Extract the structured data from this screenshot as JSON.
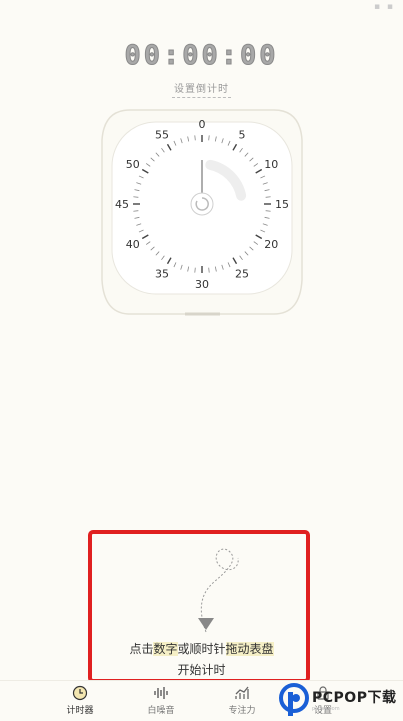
{
  "status_icons": "▪ ▪",
  "timer": {
    "display": "00:00:00",
    "set_countdown_label": "设置倒计时",
    "dial_numbers": [
      "0",
      "5",
      "10",
      "15",
      "20",
      "25",
      "30",
      "35",
      "40",
      "45",
      "50",
      "55"
    ]
  },
  "hint": {
    "line1_prefix": "点击",
    "line1_highlight1": "数字",
    "line1_middle": "或顺时针",
    "line1_highlight2": "拖动表盘",
    "line2": "开始计时"
  },
  "tabs": [
    {
      "label": "计时器",
      "icon": "clock-icon",
      "active": true
    },
    {
      "label": "白噪音",
      "icon": "soundwave-icon",
      "active": false
    },
    {
      "label": "专注力",
      "icon": "chart-icon",
      "active": false
    },
    {
      "label": "设置",
      "icon": "lock-icon",
      "active": false
    }
  ],
  "watermark": {
    "text": "PCPOP下载",
    "sub": "pcpop.com"
  },
  "colors": {
    "accent_red": "#e02020",
    "background": "#fcfbf6",
    "highlight": "#f5efc6"
  }
}
